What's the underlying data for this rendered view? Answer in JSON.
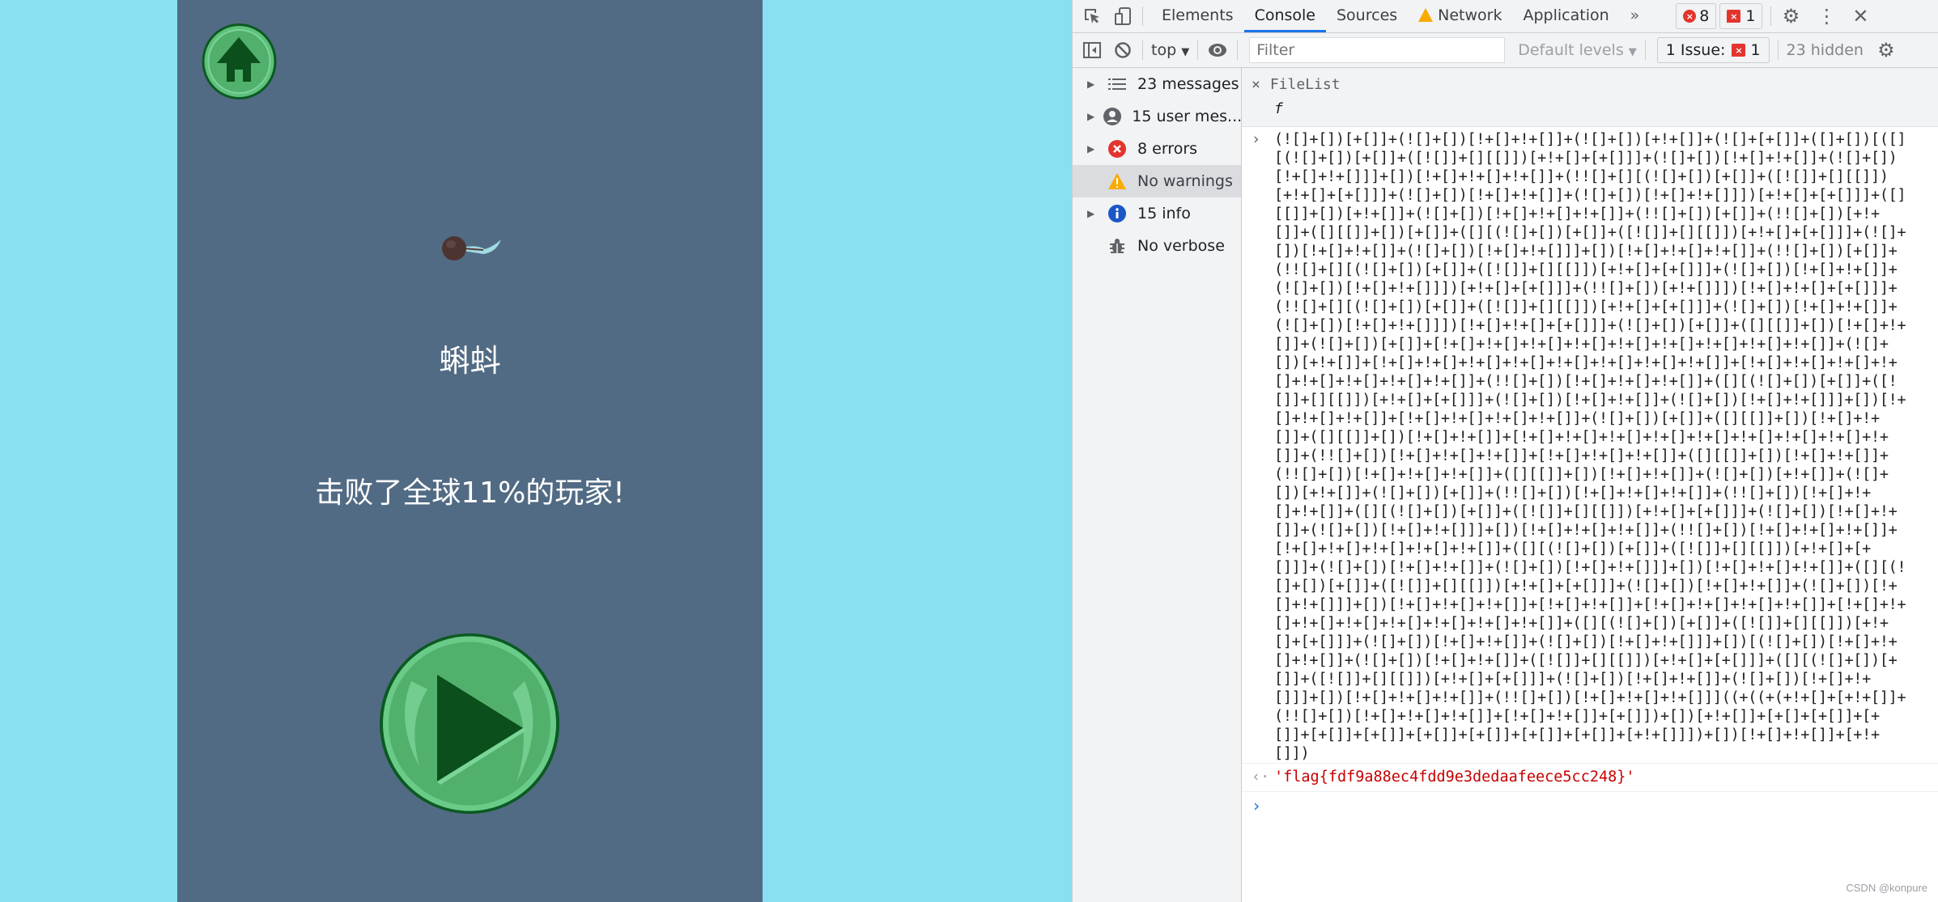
{
  "game": {
    "home_icon": "home-icon",
    "title": "蝌蚪",
    "score_text": "击败了全球11%的玩家!",
    "play_icon": "play-icon",
    "colors": {
      "page_bg": "#88e0f1",
      "panel_bg": "#526b84",
      "button_green": "#52b06d",
      "icon_dark_green": "#0a4f1c"
    }
  },
  "devtools": {
    "tabs": [
      {
        "label": "Elements"
      },
      {
        "label": "Console",
        "active": true
      },
      {
        "label": "Sources"
      },
      {
        "label": "Network",
        "warning": true
      },
      {
        "label": "Application"
      }
    ],
    "more_tabs": "»",
    "error_count": "8",
    "issue_count": "1",
    "toolbar": {
      "context": "top",
      "filter_placeholder": "Filter",
      "levels": "Default levels",
      "issues_label": "1 Issue:",
      "issues_count": "1",
      "hidden": "23 hidden"
    },
    "sidebar": [
      {
        "label": "23 messages",
        "icon": "list-icon",
        "expandable": true
      },
      {
        "label": "15 user mes...",
        "icon": "user-icon",
        "expandable": true
      },
      {
        "label": "8 errors",
        "icon": "error-icon",
        "expandable": true
      },
      {
        "label": "No warnings",
        "icon": "warning-icon",
        "expandable": false,
        "selected": true
      },
      {
        "label": "15 info",
        "icon": "info-icon",
        "expandable": true
      },
      {
        "label": "No verbose",
        "icon": "bug-icon",
        "expandable": false
      }
    ],
    "console": {
      "context_label": "FileList",
      "context_sub": "f",
      "code_lines": [
        "(![]+[])[+[]]+(![]+[])[!+[]+!+[]]+(![]+[])[+!+[]]+(![]+[+[]]+([]+[])[([]",
        "[(![]+[])[+[]]+([![]]+[][[]])[+!+[]+[+[]]]+(![]+[])[!+[]+!+[]]+(![]+[])",
        "[!+[]+!+[]]]+[])[!+[]+!+[]+!+[]]+(!![]+[][(![]+[])[+[]]+([![]]+[][[]])",
        "[+!+[]+[+[]]]+(![]+[])[!+[]+!+[]]+(![]+[])[!+[]+!+[]]])[+!+[]+[+[]]]+([]",
        "[[]]+[])[+!+[]]+(![]+[])[!+[]+!+[]+!+[]]+(!![]+[])[+[]]+(!![]+[])[+!+",
        "[]]+([][[]]+[])[+[]]+([][(![]+[])[+[]]+([![]]+[][[]])[+!+[]+[+[]]]+(![]+",
        "[])[!+[]+!+[]]+(![]+[])[!+[]+!+[]]]+[])[!+[]+!+[]+!+[]]+(!![]+[])[+[]]+",
        "(!![]+[][(![]+[])[+[]]+([![]]+[][[]])[+!+[]+[+[]]]+(![]+[])[!+[]+!+[]]+",
        "(![]+[])[!+[]+!+[]]])[+!+[]+[+[]]]+(!![]+[])[+!+[]]])[!+[]+!+[]+[+[]]]+",
        "(!![]+[][(![]+[])[+[]]+([![]]+[][[]])[+!+[]+[+[]]]+(![]+[])[!+[]+!+[]]+",
        "(![]+[])[!+[]+!+[]]])[!+[]+!+[]+[+[]]]+(![]+[])[+[]]+([][[]]+[])[!+[]+!+",
        "[]]+(![]+[])[+[]]+[!+[]+!+[]+!+[]+!+[]+!+[]+!+[]+!+[]+!+[]+!+[]]+(![]+",
        "[])[+!+[]]+[!+[]+!+[]+!+[]+!+[]+!+[]+!+[]+!+[]+!+[]]+[!+[]+!+[]+!+[]+!+",
        "[]+!+[]+!+[]+!+[]+!+[]]+(!![]+[])[!+[]+!+[]+!+[]]+([][(![]+[])[+[]]+([!",
        "[]]+[][[]])[+!+[]+[+[]]]+(![]+[])[!+[]+!+[]]+(![]+[])[!+[]+!+[]]]+[])[!+",
        "[]+!+[]+!+[]]+[!+[]+!+[]+!+[]+!+[]]+(![]+[])[+[]]+([][[]]+[])[!+[]+!+",
        "[]]+([][[]]+[])[!+[]+!+[]]+[!+[]+!+[]+!+[]+!+[]+!+[]+!+[]+!+[]+!+[]+!+",
        "[]]+(!![]+[])[!+[]+!+[]+!+[]]+[!+[]+!+[]+!+[]]+([][[]]+[])[!+[]+!+[]]+",
        "(!![]+[])[!+[]+!+[]+!+[]]+([][[]]+[])[!+[]+!+[]]+(![]+[])[+!+[]]+(![]+",
        "[])[+!+[]]+(![]+[])[+[]]+(!![]+[])[!+[]+!+[]+!+[]]+(!![]+[])[!+[]+!+",
        "[]+!+[]]+([][(![]+[])[+[]]+([![]]+[][[]])[+!+[]+[+[]]]+(![]+[])[!+[]+!+",
        "[]]+(![]+[])[!+[]+!+[]]]+[])[!+[]+!+[]+!+[]]+(!![]+[])[!+[]+!+[]+!+[]]+",
        "[!+[]+!+[]+!+[]+!+[]+!+[]]+([][(![]+[])[+[]]+([![]]+[][[]])[+!+[]+[+",
        "[]]]+(![]+[])[!+[]+!+[]]+(![]+[])[!+[]+!+[]]]+[])[!+[]+!+[]+!+[]]+([][(!",
        "[]+[])[+[]]+([![]]+[][[]])[+!+[]+[+[]]]+(![]+[])[!+[]+!+[]]+(![]+[])[!+",
        "[]+!+[]]]+[])[!+[]+!+[]+!+[]]+[!+[]+!+[]]+[!+[]+!+[]+!+[]+!+[]]+[!+[]+!+",
        "[]+!+[]+!+[]+!+[]+!+[]+!+[]+!+[]]+([][(![]+[])[+[]]+([![]]+[][[]])[+!+",
        "[]+[+[]]]+(![]+[])[!+[]+!+[]]+(![]+[])[!+[]+!+[]]]+[])[(![]+[])[!+[]+!+",
        "[]+!+[]]+(![]+[])[!+[]+!+[]]+([![]]+[][[]])[+!+[]+[+[]]]+([][(![]+[])[+",
        "[]]+([![]]+[][[]])[+!+[]+[+[]]]+(![]+[])[!+[]+!+[]]+(![]+[])[!+[]+!+",
        "[]]]+[])[!+[]+!+[]+!+[]]+(!![]+[])[!+[]+!+[]+!+[]]]((+((+(+!+[]+[+!+[]]+",
        "(!![]+[])[!+[]+!+[]+!+[]]+[!+[]+!+[]]+[+[]])+[])[+!+[]]+[+[]+[+[]]+[+",
        "[]]+[+[]]+[+[]]+[+[]]+[+[]]+[+[]]+[+[]]+[+!+[]]])+[])[!+[]+!+[]]+[+!+",
        "[]])"
      ],
      "result": "'flag{fdf9a88ec4fdd9e3dedaafeece5cc248}'"
    },
    "watermark": "CSDN @konpure"
  }
}
